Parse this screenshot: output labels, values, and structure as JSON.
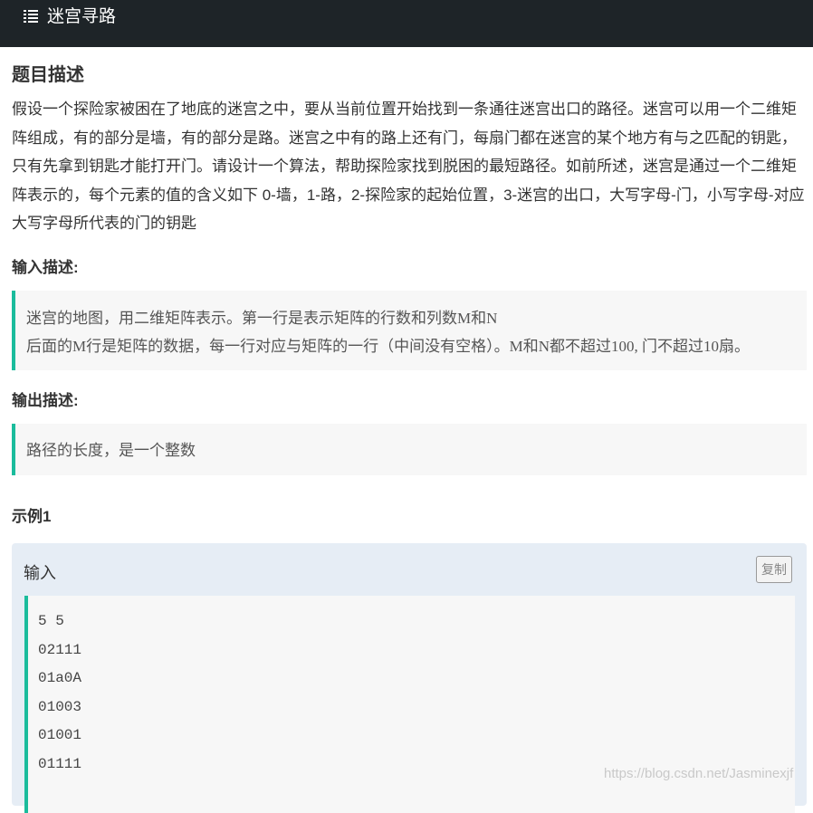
{
  "header": {
    "title": "迷宫寻路",
    "icon": "list-icon",
    "background": "#1e2428"
  },
  "problem": {
    "heading": "题目描述",
    "description": "假设一个探险家被困在了地底的迷宫之中，要从当前位置开始找到一条通往迷宫出口的路径。迷宫可以用一个二维矩阵组成，有的部分是墙，有的部分是路。迷宫之中有的路上还有门，每扇门都在迷宫的某个地方有与之匹配的钥匙，只有先拿到钥匙才能打开门。请设计一个算法，帮助探险家找到脱困的最短路径。如前所述，迷宫是通过一个二维矩阵表示的，每个元素的值的含义如下 0-墙，1-路，2-探险家的起始位置，3-迷宫的出口，大写字母-门，小写字母-对应大写字母所代表的门的钥匙"
  },
  "input_desc": {
    "heading": "输入描述:",
    "lines": [
      "迷宫的地图，用二维矩阵表示。第一行是表示矩阵的行数和列数M和N",
      "后面的M行是矩阵的数据，每一行对应与矩阵的一行（中间没有空格）。M和N都不超过100, 门不超过10扇。"
    ]
  },
  "output_desc": {
    "heading": "输出描述:",
    "text": "路径的长度，是一个整数"
  },
  "example": {
    "heading": "示例1",
    "input_label": "输入",
    "copy_label": "复制",
    "code_lines": [
      "5 5",
      "02111",
      "01a0A",
      "01003",
      "01001",
      "01111"
    ]
  },
  "watermark": "https://blog.csdn.net/Jasminexjf",
  "colors": {
    "accent": "#1abc9c",
    "example_bg": "#e6edf5",
    "quote_bg": "#f7f7f7"
  }
}
